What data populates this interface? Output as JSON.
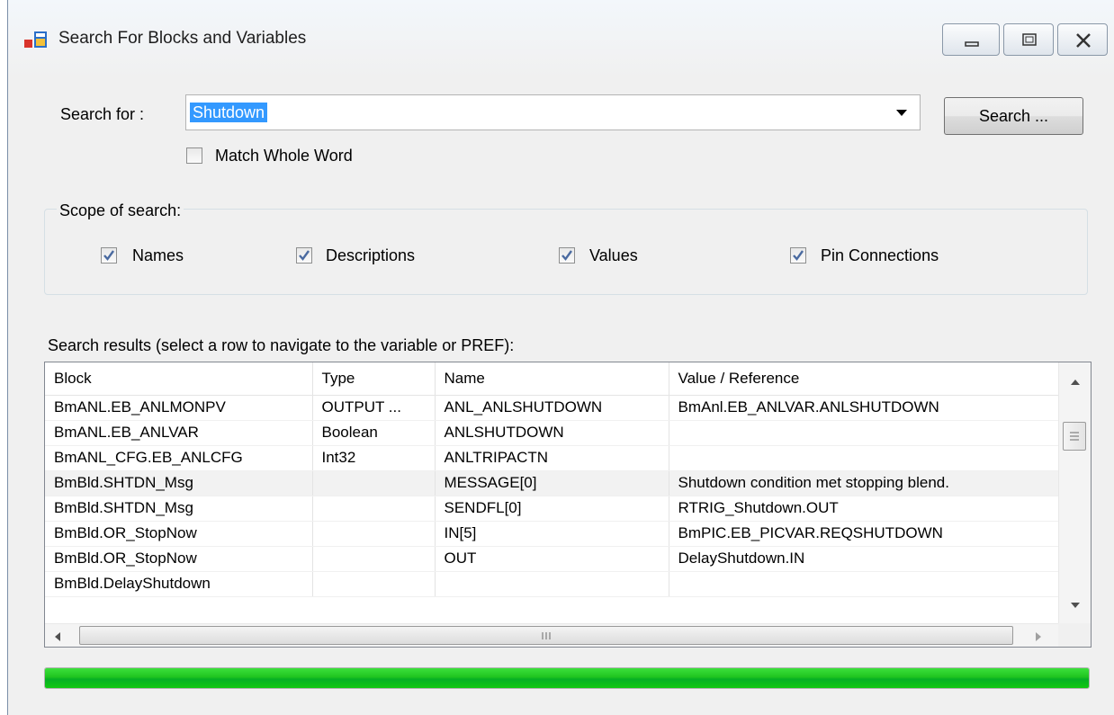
{
  "window": {
    "title": "Search For Blocks and Variables",
    "controls": [
      "minimize-icon",
      "maximize-icon",
      "close-icon"
    ]
  },
  "search": {
    "label": "Search for :",
    "value": "Shutdown",
    "button_label": "Search ...",
    "match_whole_word": {
      "label": "Match Whole Word",
      "checked": false
    }
  },
  "scope": {
    "title": "Scope of search:",
    "options": [
      {
        "label": "Names",
        "checked": true
      },
      {
        "label": "Descriptions",
        "checked": true
      },
      {
        "label": "Values",
        "checked": true
      },
      {
        "label": "Pin Connections",
        "checked": true
      }
    ]
  },
  "results": {
    "caption": "Search results (select a row to navigate to the variable or PREF):",
    "columns": [
      "Block",
      "Type",
      "Name",
      "Value / Reference"
    ],
    "rows": [
      [
        "BmANL.EB_ANLMONPV",
        "OUTPUT ...",
        "ANL_ANLSHUTDOWN",
        "BmAnl.EB_ANLVAR.ANLSHUTDOWN"
      ],
      [
        "BmANL.EB_ANLVAR",
        "Boolean",
        "ANLSHUTDOWN",
        ""
      ],
      [
        "BmANL_CFG.EB_ANLCFG",
        "Int32",
        "ANLTRIPACTN",
        ""
      ],
      [
        "BmBld.SHTDN_Msg",
        "",
        "MESSAGE[0]",
        "Shutdown condition met stopping blend."
      ],
      [
        "BmBld.SHTDN_Msg",
        "",
        "SENDFL[0]",
        "RTRIG_Shutdown.OUT"
      ],
      [
        "BmBld.OR_StopNow",
        "",
        "IN[5]",
        "BmPIC.EB_PICVAR.REQSHUTDOWN"
      ],
      [
        "BmBld.OR_StopNow",
        "",
        "OUT",
        "DelayShutdown.IN"
      ],
      [
        "BmBld.DelayShutdown",
        "",
        "",
        ""
      ]
    ],
    "selected_row": 3
  },
  "progress": {
    "value_percent": 100,
    "color": "#06b025"
  },
  "colors": {
    "selection": "#3399ff",
    "window_bg": "#f0f0f0"
  }
}
